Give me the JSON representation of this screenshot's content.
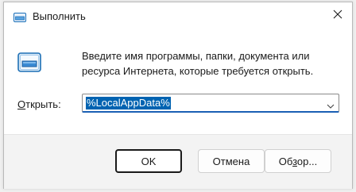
{
  "window": {
    "title": "Выполнить",
    "close_icon": "close-icon",
    "app_icon": "run-icon"
  },
  "description": {
    "line1": "Введите имя программы, папки, документа или",
    "line2": "ресурса Интернета, которые требуется открыть."
  },
  "open_field": {
    "label_accel": "О",
    "label_rest": "ткрыть:",
    "value": "%LocalAppData%",
    "value_selected": true,
    "dropdown_icon": "chevron-down-icon"
  },
  "buttons": {
    "ok": "OK",
    "cancel": "Отмена",
    "browse_prefix": "Об",
    "browse_accel": "з",
    "browse_suffix": "ор..."
  },
  "colors": {
    "accent": "#0063b1",
    "selection": "#0063b1"
  }
}
